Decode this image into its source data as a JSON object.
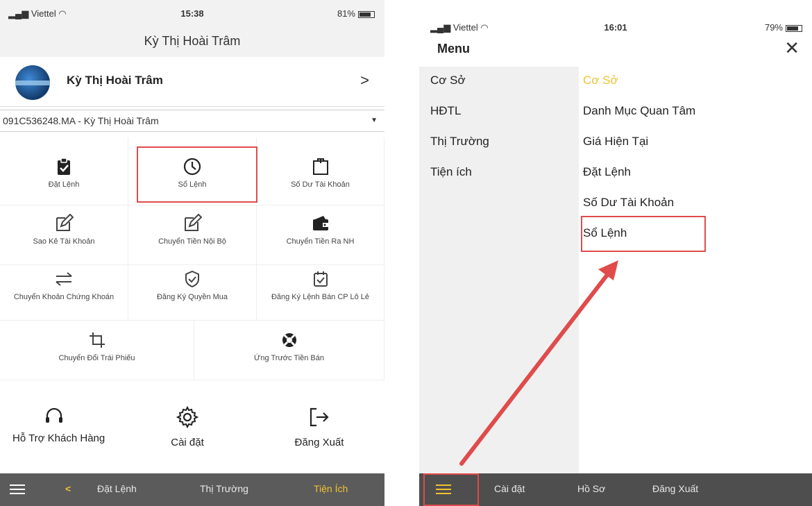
{
  "left": {
    "status": {
      "carrier": "Viettel",
      "time": "15:38",
      "battery": "81%"
    },
    "nav_title": "Kỳ Thị Hoài Trâm",
    "profile": {
      "name": "Kỳ Thị Hoài Trâm",
      "chevron": ">"
    },
    "account": {
      "value": "091C536248.MA - Kỳ Thị Hoài Trâm",
      "caret": "▼"
    },
    "grid": [
      {
        "label": "Đặt Lệnh",
        "icon": "clipboard-check-icon"
      },
      {
        "label": "Sổ Lệnh",
        "icon": "clock-icon"
      },
      {
        "label": "Số Dư Tài Khoản",
        "icon": "bag-icon"
      },
      {
        "label": "Sao Kê Tài Khoản",
        "icon": "edit-icon"
      },
      {
        "label": "Chuyển Tiền Nội Bộ",
        "icon": "edit-icon"
      },
      {
        "label": "Chuyển Tiền Ra NH",
        "icon": "wallet-icon"
      },
      {
        "label": "Chuyển Khoản Chứng Khoán",
        "icon": "transfer-arrows-icon"
      },
      {
        "label": "Đăng Ký Quyền Mua",
        "icon": "shield-check-icon"
      },
      {
        "label": "Đăng Ký Lệnh Bán CP Lô Lẻ",
        "icon": "calendar-check-icon"
      },
      {
        "label": "Chuyển Đổi Trái Phiếu",
        "icon": "crop-icon"
      },
      {
        "label": "Ứng Trước Tiền Bán",
        "icon": "lifebuoy-icon"
      }
    ],
    "actions": [
      {
        "label": "Hỗ Trợ Khách Hàng",
        "icon": "headset-icon"
      },
      {
        "label": "Cài đặt",
        "icon": "gear-icon"
      },
      {
        "label": "Đăng Xuất",
        "icon": "logout-icon"
      }
    ],
    "tabbar": {
      "back": "<",
      "tab1": "Đặt Lệnh",
      "tab2": "Thị Trường",
      "tab3": "Tiện Ích"
    }
  },
  "right": {
    "status": {
      "carrier": "Viettel",
      "time": "16:01",
      "battery": "79%"
    },
    "menu_title": "Menu",
    "close": "✕",
    "categories": [
      "Cơ Sở",
      "HĐTL",
      "Thị Trường",
      "Tiện ích"
    ],
    "items": [
      "Cơ Sở",
      "Danh Mục Quan Tâm",
      "Giá Hiện Tại",
      "Đặt Lệnh",
      "Số Dư Tài Khoản",
      "Sổ Lệnh"
    ],
    "tabbar": {
      "tab1": "Cài đặt",
      "tab2": "Hồ Sơ",
      "tab3": "Đăng Xuất"
    }
  },
  "colors": {
    "accent": "#f2c230",
    "highlight": "#e04b4b",
    "tabbar": "#5b5b5b",
    "arrow": "#e04b4b"
  }
}
